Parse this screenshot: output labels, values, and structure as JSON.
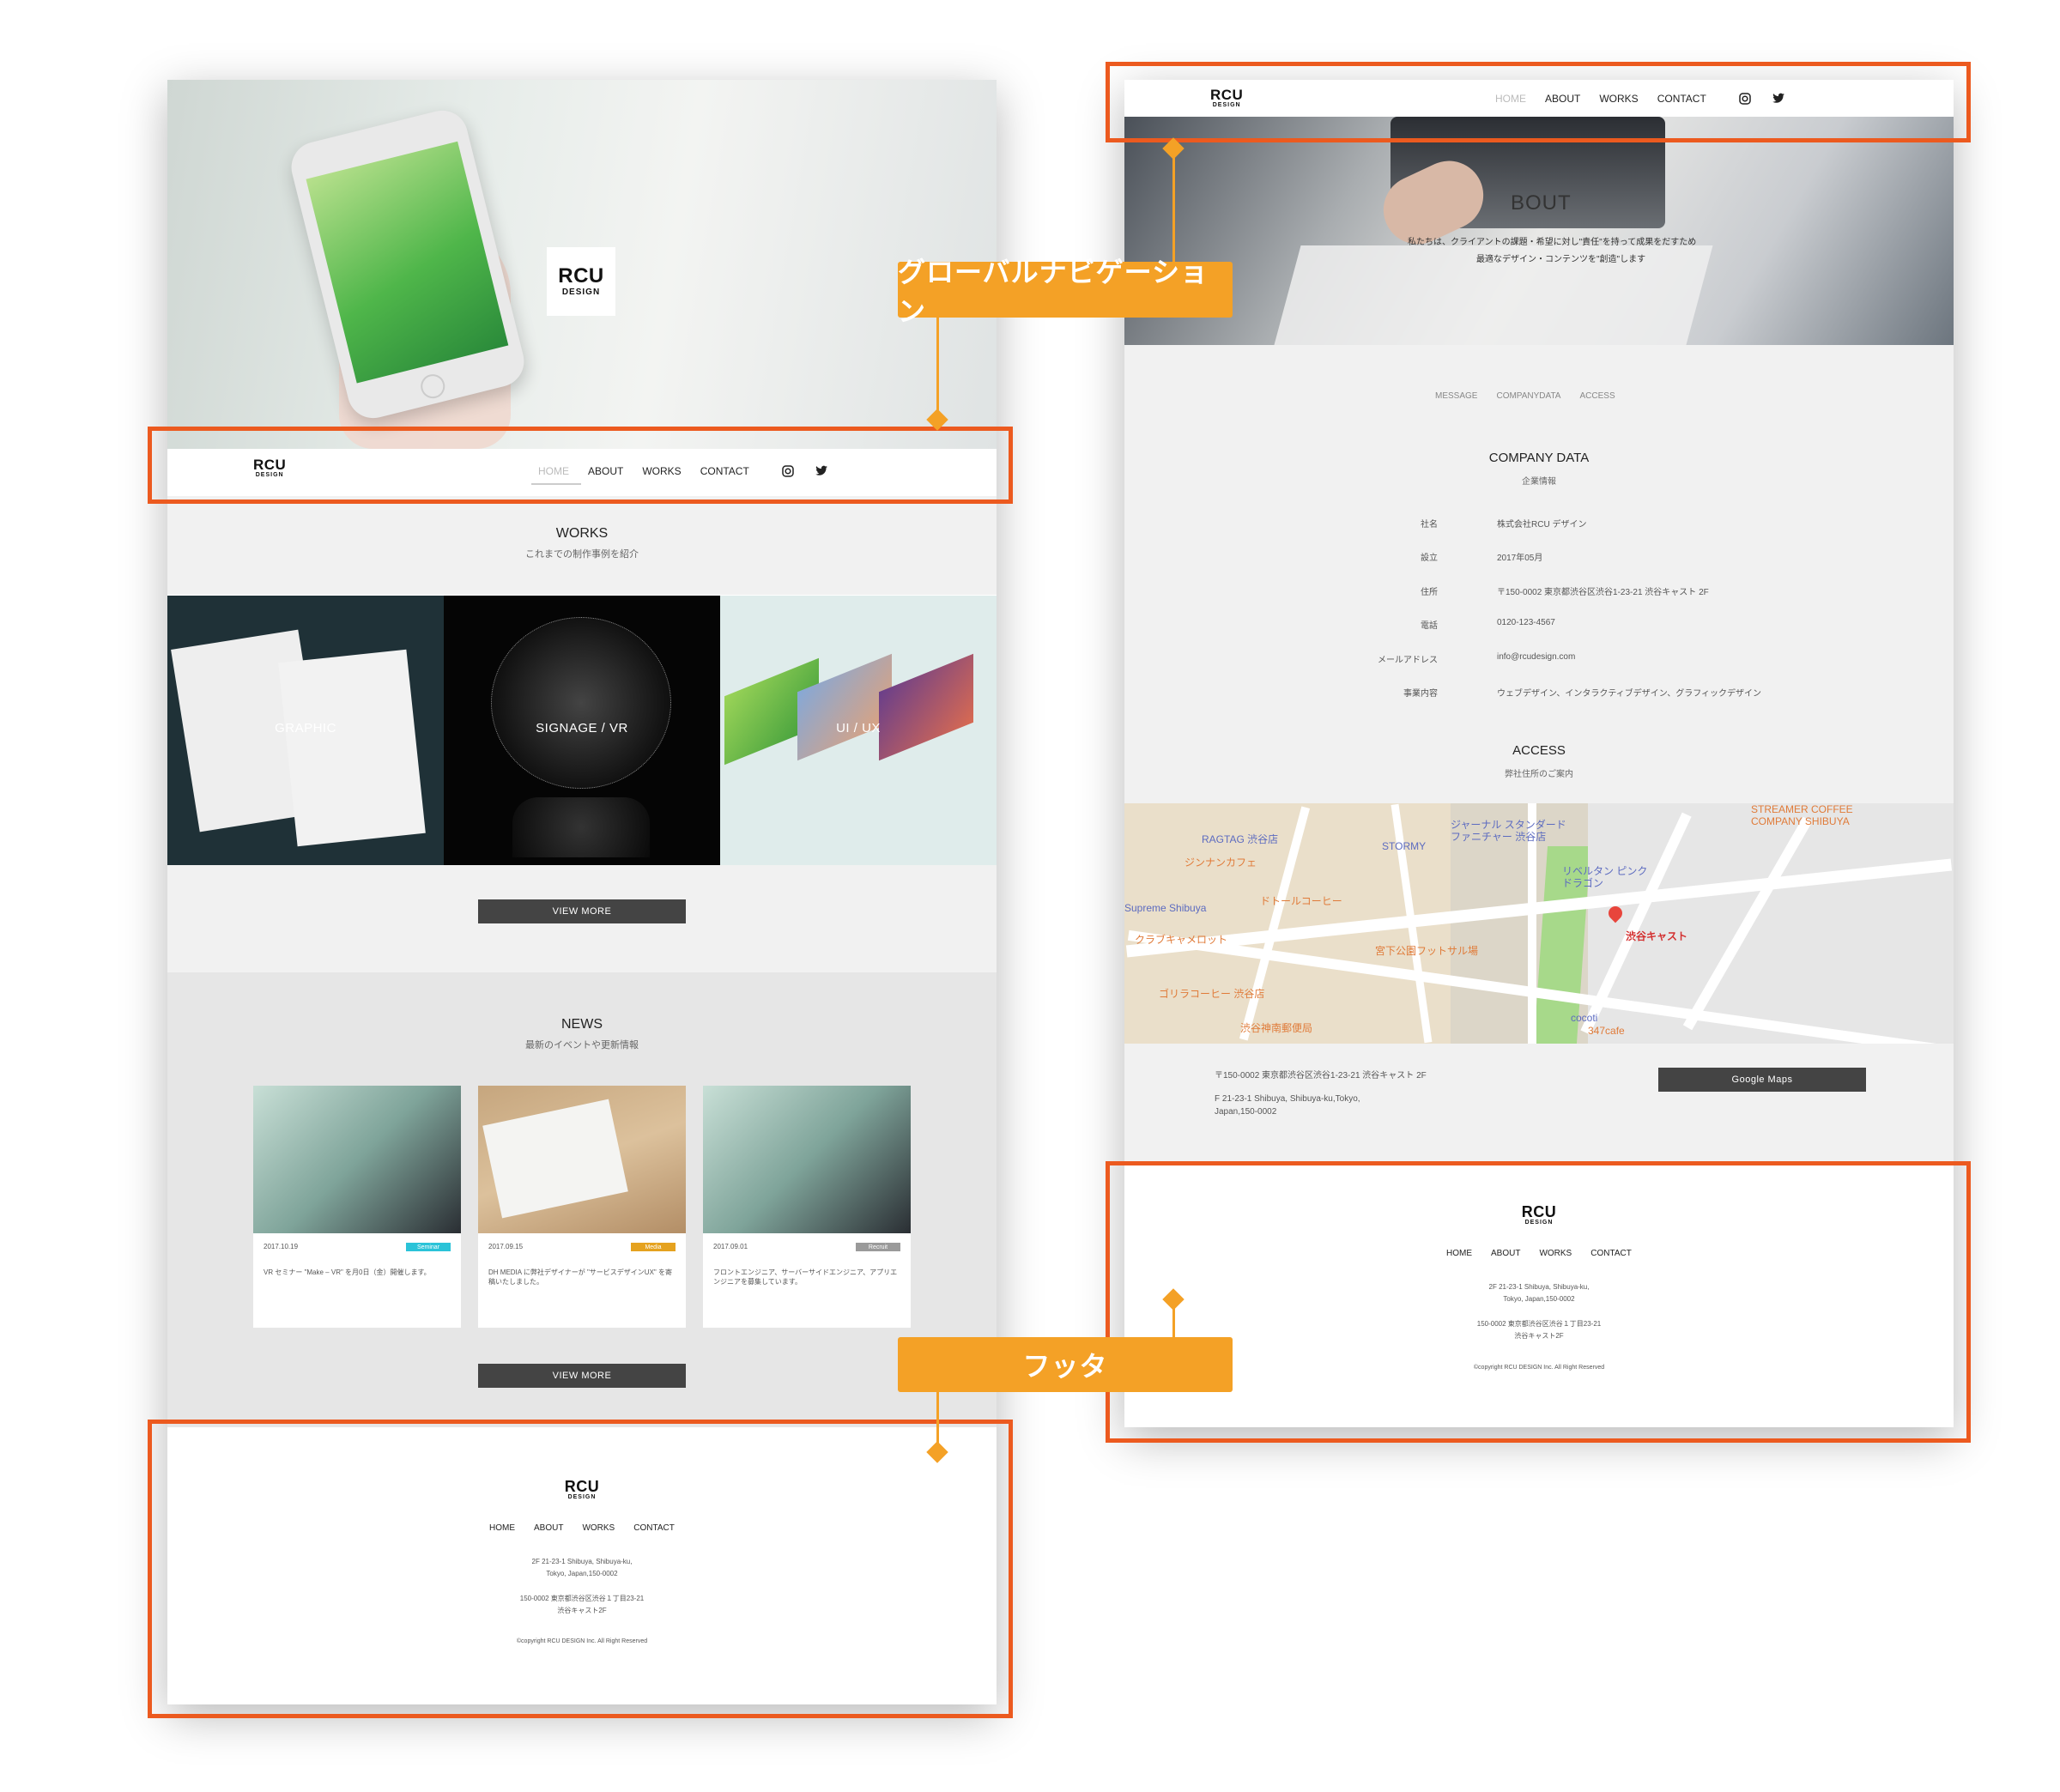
{
  "colors": {
    "highlight": "#ec5a1f",
    "callout": "#f4a126",
    "button": "#444444",
    "badge_seminar": "#2bc3d8",
    "badge_media": "#e5a21f",
    "badge_recruit": "#9a9a9a"
  },
  "logo": {
    "line1": "RCU",
    "line2": "DESIGN"
  },
  "nav": {
    "home": "HOME",
    "about": "ABOUT",
    "works": "WORKS",
    "contact": "CONTACT",
    "instagram_icon": "instagram-icon",
    "twitter_icon": "twitter-icon"
  },
  "callouts": {
    "global_nav": "グローバルナビゲーション",
    "footer": "フッタ"
  },
  "home": {
    "works": {
      "title": "WORKS",
      "subtitle": "これまでの制作事例を紹介",
      "tiles": [
        "GRAPHIC",
        "SIGNAGE / VR",
        "UI / UX"
      ]
    },
    "view_more": "VIEW MORE",
    "news": {
      "title": "NEWS",
      "subtitle": "最新のイベントや更新情報",
      "items": [
        {
          "date": "2017.10.19",
          "badge": "Seminar",
          "text": "VR セミナー \"Make – VR\" を月0日（金）開催します。"
        },
        {
          "date": "2017.09.15",
          "badge": "Media",
          "text": "DH MEDIA に弊社デザイナーが \"サービスデザインUX\" を寄稿いたしました。"
        },
        {
          "date": "2017.09.01",
          "badge": "Recruit",
          "text": "フロントエンジニア、サーバーサイドエンジニア、アプリエンジニアを募集しています。"
        }
      ]
    }
  },
  "about": {
    "hero_title": "BOUT",
    "hero_text1": "私たちは、クライアントの課題・希望に対し\"責任\"を持って成果をだすため",
    "hero_text2": "最適なデザイン・コンテンツを\"創造\"します",
    "subnav": [
      "MESSAGE",
      "COMPANYDATA",
      "ACCESS"
    ],
    "company": {
      "title": "COMPANY DATA",
      "subtitle": "企業情報",
      "rows": [
        {
          "label": "社名",
          "value": "株式会社RCU デザイン"
        },
        {
          "label": "設立",
          "value": "2017年05月"
        },
        {
          "label": "住所",
          "value": "〒150-0002 東京都渋谷区渋谷1-23-21 渋谷キャスト 2F"
        },
        {
          "label": "電話",
          "value": "0120-123-4567"
        },
        {
          "label": "メールアドレス",
          "value": "info@rcudesign.com"
        },
        {
          "label": "事業内容",
          "value": "ウェブデザイン、インタラクティブデザイン、グラフィックデザイン"
        }
      ]
    },
    "access": {
      "title": "ACCESS",
      "subtitle": "弊社住所のご案内",
      "addr_jp": "〒150-0002 東京都渋谷区渋谷1-23-21 渋谷キャスト 2F",
      "addr_en1": "F 21-23-1 Shibuya, Shibuya-ku,Tokyo,",
      "addr_en2": "Japan,150-0002",
      "maps_button": "Google Maps"
    },
    "map_labels": {
      "ragtag": "RAGTAG 渋谷店",
      "stormy": "STORMY",
      "jinnan": "ジンナンカフェ",
      "standard": "ジャーナル スタンダード ファニチャー 渋谷店",
      "streamer": "STREAMER COFFEE COMPANY SHIBUYA",
      "doutor": "ドトールコーヒー",
      "supreme": "Supreme Shibuya",
      "club": "クラブキャメロット",
      "miyashita": "宮下公園フットサル場",
      "gorilla": "ゴリラコーヒー 渋谷店",
      "post": "渋谷神南郵便局",
      "cast": "渋谷キャスト",
      "pink": "リベルタン ピンクドラゴン",
      "cocoti": "cocoti",
      "cafe347": "347cafe"
    }
  },
  "footer": {
    "addr1": "2F 21-23-1 Shibuya, Shibuya-ku,",
    "addr2": "Tokyo, Japan,150-0002",
    "addr3": "150-0002 東京都渋谷区渋谷１丁目23-21",
    "addr4": "渋谷キャスト2F",
    "copyright": "©copyright RCU DESIGN Inc. All Right Reserved"
  }
}
